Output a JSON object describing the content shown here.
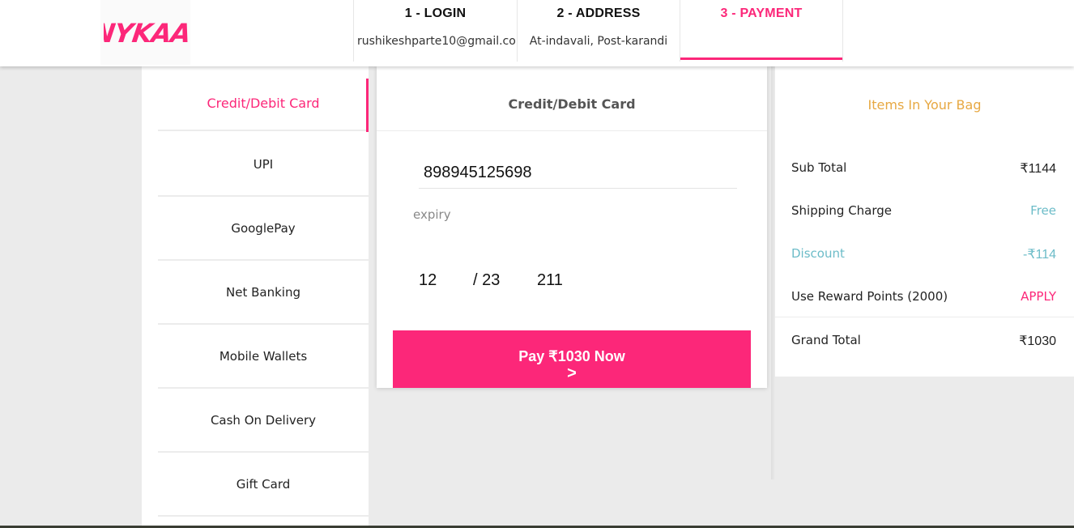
{
  "brand": {
    "logo_text": "NYKAA",
    "accent": "#fc2779"
  },
  "steps": [
    {
      "title": "1 - LOGIN",
      "sub": "rushikeshparte10@gmail.com"
    },
    {
      "title": "2 - ADDRESS",
      "sub": "At-indavali, Post-karandi"
    },
    {
      "title": "3 - PAYMENT",
      "sub": ""
    }
  ],
  "payment_methods": [
    {
      "label": "Credit/Debit Card"
    },
    {
      "label": "UPI"
    },
    {
      "label": "GooglePay"
    },
    {
      "label": "Net Banking"
    },
    {
      "label": "Mobile Wallets"
    },
    {
      "label": "Cash On Delivery"
    },
    {
      "label": "Gift Card"
    }
  ],
  "card_form": {
    "header": "Credit/Debit Card",
    "card_number": "898945125698",
    "expiry_label": "expiry",
    "expiry_month": "12",
    "expiry_year": "/ 23",
    "cvv": "211",
    "pay_label": "Pay ₹1030 Now",
    "pay_arrow": ">"
  },
  "bag": {
    "title": "Items In Your Bag",
    "sub_total_label": "Sub Total",
    "sub_total": "₹1144",
    "shipping_label": "Shipping Charge",
    "shipping": "Free",
    "discount_label": "Discount",
    "discount": "-₹114",
    "reward_label": "Use Reward Points (2000)",
    "reward_action": "APPLY",
    "grand_total_label": "Grand Total",
    "grand_total": "₹1030"
  }
}
